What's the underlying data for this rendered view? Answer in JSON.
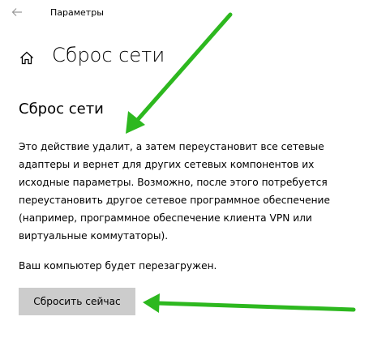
{
  "window": {
    "app_title": "Параметры"
  },
  "header": {
    "page_title": "Сброс сети"
  },
  "content": {
    "section_title": "Сброс сети",
    "description": "Это действие удалит, а затем переустановит все сетевые адаптеры и вернет для других сетевых компонентов их исходные параметры. Возможно, после этого потребуется переустановить другое сетевое программное обеспечение (например, программное обеспечение клиента VPN или виртуальные коммутаторы).",
    "restart_note": "Ваш компьютер будет перезагружен.",
    "reset_button_label": "Сбросить сейчас"
  },
  "icons": {
    "back": "back-arrow-icon",
    "home": "home-icon"
  },
  "colors": {
    "button_bg": "#cccccc",
    "annotation_arrow": "#2db81f"
  }
}
